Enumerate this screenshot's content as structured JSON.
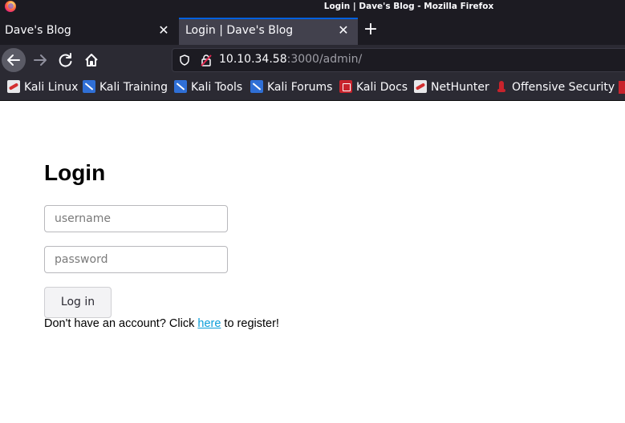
{
  "window": {
    "title": "Login | Dave's Blog - Mozilla Firefox"
  },
  "tabs": [
    {
      "label": "Dave's Blog",
      "active": false
    },
    {
      "label": "Login | Dave's Blog",
      "active": true
    }
  ],
  "nav": {
    "url_host": "10.10.34.58",
    "url_rest": ":3000/admin/"
  },
  "bookmarks": [
    {
      "label": "Kali Linux",
      "icon": "kali-icon"
    },
    {
      "label": "Kali Training",
      "icon": "kali-training-icon"
    },
    {
      "label": "Kali Tools",
      "icon": "kali-tools-icon"
    },
    {
      "label": "Kali Forums",
      "icon": "kali-forums-icon"
    },
    {
      "label": "Kali Docs",
      "icon": "kali-docs-icon"
    },
    {
      "label": "NetHunter",
      "icon": "nethunter-icon"
    },
    {
      "label": "Offensive Security",
      "icon": "offensive-security-icon"
    }
  ],
  "page": {
    "heading": "Login",
    "username_placeholder": "username",
    "password_placeholder": "password",
    "login_button": "Log in",
    "register_prefix": "Don't have an account? Click ",
    "register_link": "here",
    "register_suffix": " to register!"
  },
  "colors": {
    "chrome_dark": "#1c1b22",
    "toolbar": "#2b2a33",
    "active_tab": "#42414d",
    "tab_accent": "#0060df",
    "link": "#0a9ed8"
  }
}
